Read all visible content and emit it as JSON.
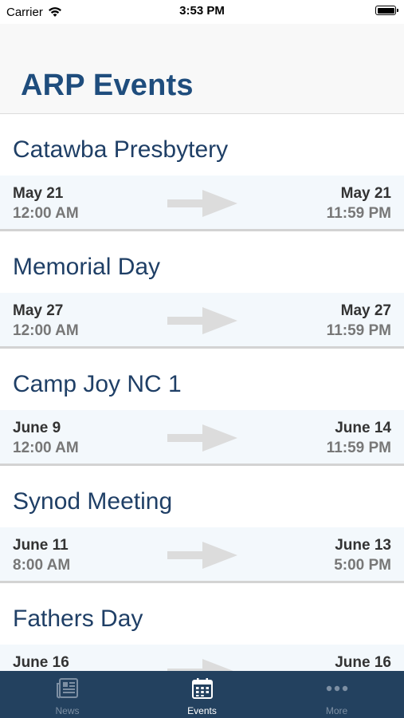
{
  "status_bar": {
    "carrier": "Carrier",
    "time": "3:53 PM"
  },
  "header": {
    "title": "ARP Events"
  },
  "events": [
    {
      "title": "Catawba Presbytery",
      "start_date": "May 21",
      "start_time": "12:00 AM",
      "end_date": "May 21",
      "end_time": "11:59 PM"
    },
    {
      "title": "Memorial Day",
      "start_date": "May 27",
      "start_time": "12:00 AM",
      "end_date": "May 27",
      "end_time": "11:59 PM"
    },
    {
      "title": "Camp Joy NC 1",
      "start_date": "June 9",
      "start_time": "12:00 AM",
      "end_date": "June 14",
      "end_time": "11:59 PM"
    },
    {
      "title": "Synod Meeting",
      "start_date": "June 11",
      "start_time": "8:00 AM",
      "end_date": "June 13",
      "end_time": "5:00 PM"
    },
    {
      "title": "Fathers Day",
      "start_date": "June 16",
      "start_time": "",
      "end_date": "June 16",
      "end_time": ""
    }
  ],
  "tab_bar": {
    "tabs": [
      {
        "label": "News",
        "icon": "newspaper-icon",
        "active": false
      },
      {
        "label": "Events",
        "icon": "calendar-icon",
        "active": true
      },
      {
        "label": "More",
        "icon": "more-dots-icon",
        "active": false
      }
    ]
  },
  "colors": {
    "title": "#1f4d7d",
    "event_title": "#1f3f66",
    "tab_bar_bg": "#23415f",
    "date_row_bg": "#f3f8fc",
    "arrow": "#dcdcdc"
  }
}
